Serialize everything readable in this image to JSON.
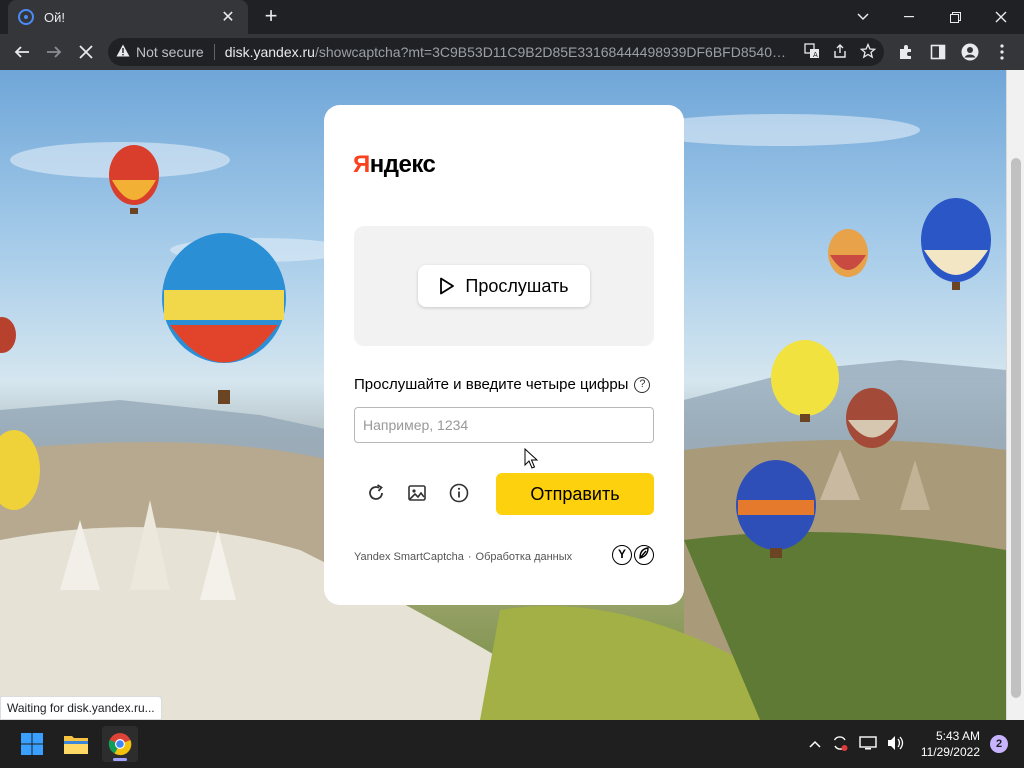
{
  "browser": {
    "tab_title": "Ой!",
    "tab_close_glyph": "✕",
    "new_tab_glyph": "+",
    "not_secure": "Not secure",
    "url_domain": "disk.yandex.ru",
    "url_path": "/showcaptcha?mt=3C9B53D11C9B2D85E33168444498939DF6BFD8540F5...",
    "status_text": "Waiting for disk.yandex.ru..."
  },
  "captcha": {
    "logo_first": "Я",
    "logo_rest": "ндекс",
    "listen_label": "Прослушать",
    "instruction": "Прослушайте и введите четыре цифры",
    "help_glyph": "?",
    "input_placeholder": "Например, 1234",
    "input_value": "",
    "submit_label": "Отправить",
    "footer_brand": "Yandex SmartCaptcha",
    "footer_sep": "·",
    "footer_link": "Обработка данных"
  },
  "taskbar": {
    "time": "5:43 AM",
    "date": "11/29/2022",
    "notifications": "2"
  },
  "colors": {
    "accent_yellow": "#fdd10e",
    "yandex_red": "#fc3f1d",
    "chrome_dark": "#202124",
    "chrome_toolbar": "#35363a"
  },
  "icons": {
    "browser": [
      "back-icon",
      "forward-icon",
      "stop-icon",
      "warning-icon",
      "translate-icon",
      "share-icon",
      "star-icon",
      "extensions-icon",
      "sidepanel-icon",
      "profile-icon",
      "menu-icon"
    ],
    "captcha": [
      "play-icon",
      "help-icon",
      "refresh-icon",
      "image-icon",
      "info-icon",
      "yandex-y-icon",
      "yandex-leaf-icon"
    ],
    "taskbar": [
      "windows-start-icon",
      "file-explorer-icon",
      "chrome-icon",
      "chevron-up-icon",
      "sync-icon",
      "display-icon",
      "volume-icon"
    ]
  }
}
